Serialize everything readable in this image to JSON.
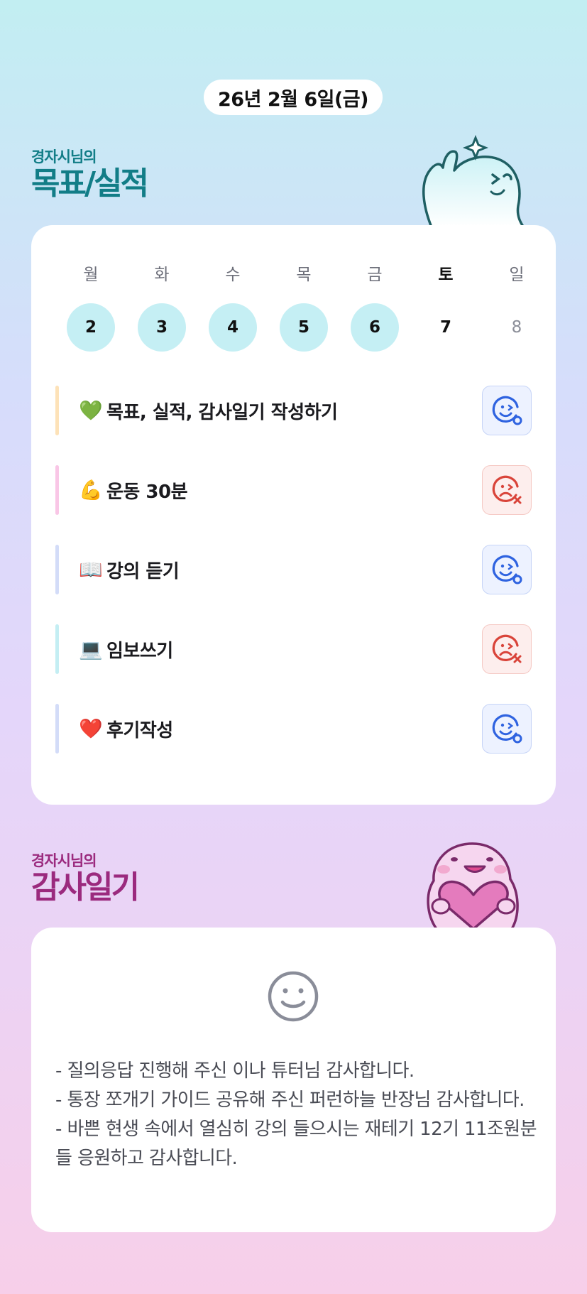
{
  "date_label": "26년 2월 6일(금)",
  "goal_section": {
    "subtitle": "경자시님의",
    "title": "목표/실적"
  },
  "week": [
    {
      "day": "월",
      "date": "2",
      "done": true
    },
    {
      "day": "화",
      "date": "3",
      "done": true
    },
    {
      "day": "수",
      "date": "4",
      "done": true
    },
    {
      "day": "목",
      "date": "5",
      "done": true
    },
    {
      "day": "금",
      "date": "6",
      "done": true
    },
    {
      "day": "토",
      "date": "7",
      "done": false,
      "today": true
    },
    {
      "day": "일",
      "date": "8",
      "done": false,
      "sunday": true
    }
  ],
  "goals": [
    {
      "emoji": "💚",
      "text": "목표, 실적, 감사일기 작성하기",
      "bar_color": "#fde2b8",
      "status": "success"
    },
    {
      "emoji": "💪",
      "text": "운동 30분",
      "bar_color": "#f9c6e6",
      "status": "fail"
    },
    {
      "emoji": "📖",
      "text": "강의 듣기",
      "bar_color": "#d3dcf8",
      "status": "success"
    },
    {
      "emoji": "💻",
      "text": "임보쓰기",
      "bar_color": "#c4eef3",
      "status": "fail"
    },
    {
      "emoji": "❤️",
      "text": "후기작성",
      "bar_color": "#d3dcf8",
      "status": "success"
    }
  ],
  "gratitude_section": {
    "subtitle": "경자시님의",
    "title": "감사일기"
  },
  "gratitude_lines": [
    "- 질의응답 진행해 주신 이나 튜터님 감사합니다.",
    "- 통장 쪼개기 가이드 공유해 주신 퍼런하늘 반장님 감사합니다.",
    "- 바쁜 현생 속에서 열심히 강의 들으시는 재테기 12기 11조원분들 응원하고 감사합니다."
  ],
  "colors": {
    "success_icon": "#2f63e0",
    "fail_icon": "#d9443a",
    "goal_title": "#127d87",
    "gratitude_title": "#9b2a7e"
  }
}
